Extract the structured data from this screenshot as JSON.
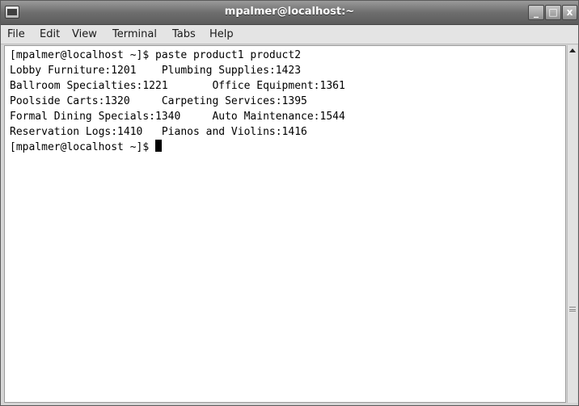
{
  "window": {
    "title": "mpalmer@localhost:~",
    "controls": {
      "minimize": "_",
      "maximize": "□",
      "close": "x"
    }
  },
  "menubar": {
    "items": [
      {
        "label": "File"
      },
      {
        "label": "Edit"
      },
      {
        "label": "View"
      },
      {
        "label": "Terminal"
      },
      {
        "label": "Tabs"
      },
      {
        "label": "Help"
      }
    ]
  },
  "terminal": {
    "lines": [
      "[mpalmer@localhost ~]$ paste product1 product2",
      "Lobby Furniture:1201    Plumbing Supplies:1423",
      "Ballroom Specialties:1221       Office Equipment:1361",
      "Poolside Carts:1320     Carpeting Services:1395",
      "Formal Dining Specials:1340     Auto Maintenance:1544",
      "Reservation Logs:1410   Pianos and Violins:1416"
    ],
    "prompt": "[mpalmer@localhost ~]$ "
  },
  "colors": {
    "titlebar": "#6e6e6e",
    "menubar": "#e4e4e4",
    "terminal_bg": "#ffffff",
    "terminal_fg": "#000000"
  }
}
